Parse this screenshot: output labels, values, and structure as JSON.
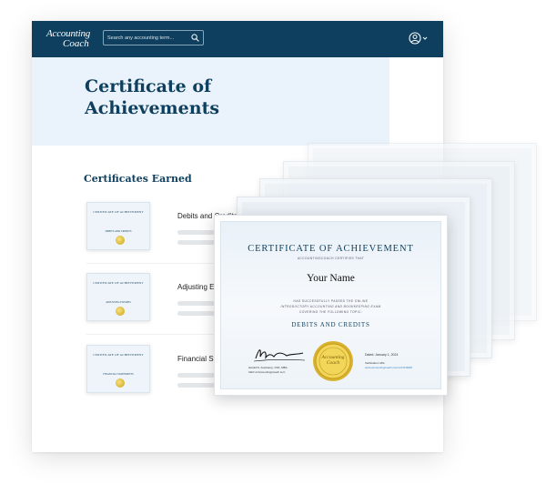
{
  "header": {
    "logo_line1": "Accounting",
    "logo_line2": "Coach",
    "search_placeholder": "Search any accounting term...",
    "brand_color": "#0e3f5e"
  },
  "hero": {
    "title": "Certificate of Achievements"
  },
  "certificates": {
    "section_title": "Certificates Earned",
    "items": [
      {
        "title": "Debits and Credits",
        "thumb_title": "CERTIFICATE OF ACHIEVEMENT",
        "thumb_topic": "DEBITS AND CREDITS"
      },
      {
        "title": "Adjusting Entries",
        "thumb_title": "CERTIFICATE OF ACHIEVEMENT",
        "thumb_topic": "ADJUSTING ENTRIES"
      },
      {
        "title": "Financial Statements",
        "thumb_title": "CERTIFICATE OF ACHIEVEMENT",
        "thumb_topic": "FINANCIAL STATEMENTS"
      }
    ]
  },
  "certificate": {
    "title": "CERTIFICATE OF ACHIEVEMENT",
    "certifies": "ACCOUNTINGCOACH CERTIFIES THAT",
    "name": "Your Name",
    "passed_line1": "HAS SUCCESSFULLY PASSED THE ONLINE",
    "passed_line2": "INTRODUCTORY ACCOUNTING AND BOOKKEEPING EXAM",
    "passed_line3": "COVERING THE FOLLOWING TOPIC:",
    "topic": "DEBITS AND CREDITS",
    "signer_name": "Harold D. Averkamp, CPA, MBA",
    "signer_role": "CEO of AccountingCoach LLC",
    "seal_line1": "Accounting",
    "seal_line2": "Coach",
    "date_label": "Dated: January 1, 2024",
    "verify_label": "Verification URL:",
    "verify_url": "www.accountingcoach.com/v/A7F2E58"
  }
}
